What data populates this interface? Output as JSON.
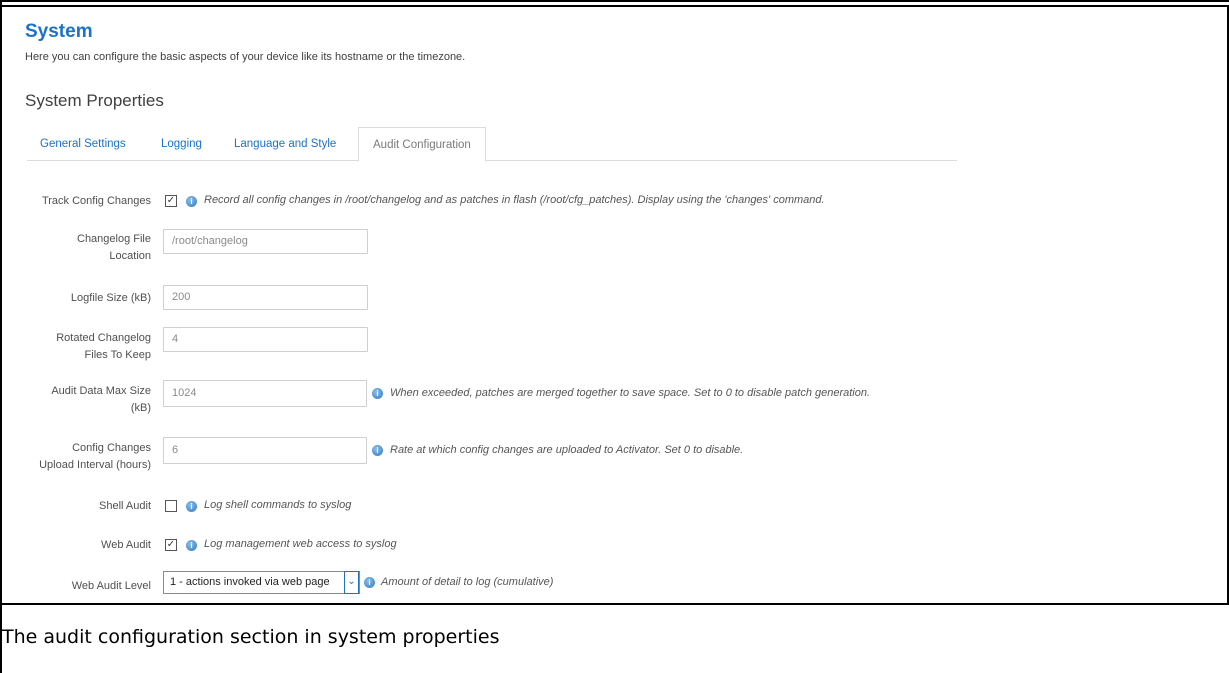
{
  "header": {
    "title": "System",
    "description": "Here you can configure the basic aspects of your device like its hostname or the timezone."
  },
  "section": {
    "title": "System Properties"
  },
  "tabs": [
    {
      "label": "General Settings"
    },
    {
      "label": "Logging"
    },
    {
      "label": "Language and Style"
    },
    {
      "label": "Audit Configuration",
      "active": true
    }
  ],
  "form": {
    "track_config_changes": {
      "label": "Track Config Changes",
      "checked": true,
      "help": "Record all config changes in /root/changelog and as patches in flash (/root/cfg_patches). Display using the 'changes' command."
    },
    "changelog_location": {
      "label_line1": "Changelog File",
      "label_line2": "Location",
      "value": "/root/changelog"
    },
    "logfile_size": {
      "label": "Logfile Size (kB)",
      "value": "200"
    },
    "rotated_files": {
      "label_line1": "Rotated Changelog",
      "label_line2": "Files To Keep",
      "value": "4"
    },
    "audit_max_size": {
      "label_line1": "Audit Data Max Size",
      "label_line2": "(kB)",
      "value": "1024",
      "help": "When exceeded, patches are merged together to save space. Set to 0 to disable patch generation."
    },
    "upload_interval": {
      "label_line1": "Config Changes",
      "label_line2": "Upload Interval (hours)",
      "value": "6",
      "help": "Rate at which config changes are uploaded to Activator. Set 0 to disable."
    },
    "shell_audit": {
      "label": "Shell Audit",
      "checked": false,
      "help": "Log shell commands to syslog"
    },
    "web_audit": {
      "label": "Web Audit",
      "checked": true,
      "help": "Log management web access to syslog"
    },
    "web_audit_level": {
      "label": "Web Audit Level",
      "selected": "1 - actions invoked via web page",
      "help": "Amount of detail to log (cumulative)"
    }
  },
  "caption": "The audit configuration section in system properties",
  "colors": {
    "accent": "#1a73c8",
    "text": "#404040"
  }
}
